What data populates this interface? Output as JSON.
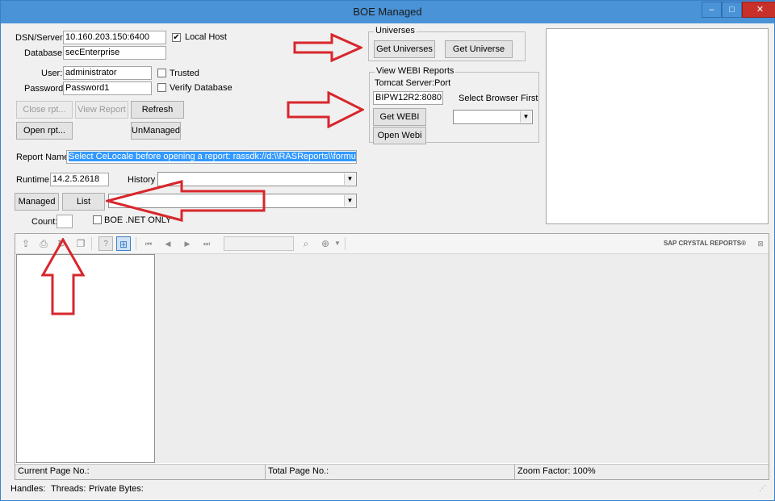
{
  "window": {
    "title": "BOE Managed",
    "minimize": "–",
    "maximize": "□",
    "close": "✕"
  },
  "connection": {
    "dsn_label": "DSN/Server:",
    "dsn_value": "10.160.203.150:6400",
    "local_host_label": "Local Host",
    "local_host_checked": true,
    "database_label": "Database:",
    "database_value": "secEnterprise",
    "user_label": "User:",
    "user_value": "administrator",
    "trusted_label": "Trusted",
    "trusted_checked": false,
    "password_label": "Password:",
    "password_value": "Password1",
    "verify_label": "Verify Database",
    "verify_checked": false
  },
  "buttons": {
    "close_rpt": "Close rpt...",
    "view_report": "View Report",
    "refresh": "Refresh",
    "open_rpt": "Open rpt...",
    "unmanaged": "UnManaged",
    "managed": "Managed",
    "list": "List"
  },
  "universes": {
    "legend": "Universes",
    "get_universes": "Get Universes",
    "get_universe": "Get Universe"
  },
  "webi": {
    "legend": "View WEBI Reports",
    "tomcat_label": "Tomcat Server:Port",
    "tomcat_value": "BIPW12R2:8080",
    "select_browser": "Select Browser First",
    "get_webi": "Get WEBI",
    "open_webi": "Open Webi"
  },
  "report": {
    "name_label": "Report Name:",
    "name_value": "Select CeLocale before opening a report: rassdk://d:\\\\RASReports\\\\formulas.rpt",
    "runtime_label": "Runtime",
    "runtime_value": "14.2.5.2618",
    "history_label": "History",
    "count_label": "Count:",
    "boe_net_label": "BOE .NET ONLY",
    "boe_net_checked": false
  },
  "viewer": {
    "brand": "SAP CRYSTAL REPORTS®",
    "current_page": "Current Page No.:",
    "total_page": "Total Page No.:",
    "zoom": "Zoom Factor: 100%"
  },
  "footer": {
    "handles": "Handles:",
    "threads": "Threads:",
    "private_bytes": "Private Bytes:"
  }
}
